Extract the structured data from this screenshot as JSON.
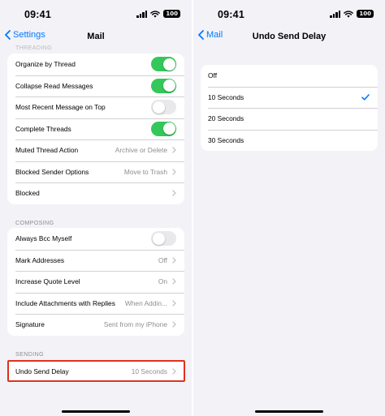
{
  "status": {
    "time": "09:41",
    "battery": "100"
  },
  "left": {
    "back_label": "Settings",
    "title": "Mail",
    "threading_header": "THREADING",
    "threading": [
      {
        "label": "Organize by Thread",
        "toggle": true
      },
      {
        "label": "Collapse Read Messages",
        "toggle": true
      },
      {
        "label": "Most Recent Message on Top",
        "toggle": false
      },
      {
        "label": "Complete Threads",
        "toggle": true
      },
      {
        "label": "Muted Thread Action",
        "value": "Archive or Delete"
      },
      {
        "label": "Blocked Sender Options",
        "value": "Move to Trash"
      },
      {
        "label": "Blocked",
        "value": ""
      }
    ],
    "composing_header": "COMPOSING",
    "composing": [
      {
        "label": "Always Bcc Myself",
        "toggle": false
      },
      {
        "label": "Mark Addresses",
        "value": "Off"
      },
      {
        "label": "Increase Quote Level",
        "value": "On"
      },
      {
        "label": "Include Attachments with Replies",
        "value": "When Addin..."
      },
      {
        "label": "Signature",
        "value": "Sent from my iPhone"
      }
    ],
    "sending_header": "SENDING",
    "sending": [
      {
        "label": "Undo Send Delay",
        "value": "10 Seconds"
      }
    ]
  },
  "right": {
    "back_label": "Mail",
    "title": "Undo Send Delay",
    "options": [
      {
        "label": "Off",
        "selected": false
      },
      {
        "label": "10 Seconds",
        "selected": true
      },
      {
        "label": "20 Seconds",
        "selected": false
      },
      {
        "label": "30 Seconds",
        "selected": false
      }
    ]
  },
  "colors": {
    "accent": "#007aff",
    "toggle_on": "#34c759",
    "highlight": "#e0311e"
  }
}
